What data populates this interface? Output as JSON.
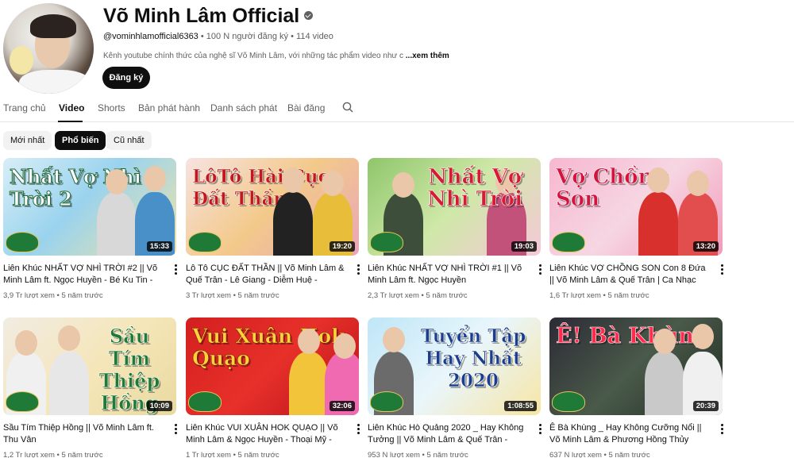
{
  "channel": {
    "name": "Võ Minh Lâm Official",
    "handle": "@vominhlamofficial6363",
    "subscribers": "100 N người đăng ký",
    "video_count": "114 video",
    "separator": "•",
    "description": "Kênh youtube chính thức của nghệ sĩ Võ Minh Lâm, với những tác phẩm video như c",
    "more_label": "...xem thêm",
    "subscribe_label": "Đăng ký"
  },
  "tabs": [
    {
      "label": "Trang chủ",
      "active": false
    },
    {
      "label": "Video",
      "active": true
    },
    {
      "label": "Shorts",
      "active": false
    },
    {
      "label": "Bản phát hành",
      "active": false
    },
    {
      "label": "Danh sách phát",
      "active": false
    },
    {
      "label": "Bài đăng",
      "active": false
    }
  ],
  "search_icon": "search-icon",
  "filters": [
    {
      "label": "Mới nhất",
      "active": false
    },
    {
      "label": "Phổ biến",
      "active": true
    },
    {
      "label": "Cũ nhất",
      "active": false
    }
  ],
  "videos": [
    {
      "title": "Liên Khúc NHẤT VỢ NHÌ TRỜI #2 || Võ Minh Lâm ft. Ngọc Huyền - Bé Ku Tin - Diễm Huệ",
      "views": "3,9 Tr lượt xem",
      "age": "5 năm trước",
      "duration": "15:33",
      "thumb_text": "Nhất Vợ Nhì Trời 2"
    },
    {
      "title": "Lô Tô CỤC ĐẤT THẦN || Võ Minh Lâm & Quế Trân - Lê Giang - Diễm Huệ - Cường Phạm",
      "views": "3 Tr lượt xem",
      "age": "5 năm trước",
      "duration": "19:20",
      "thumb_text": "LôTô Hài Cục Đất Thần"
    },
    {
      "title": "Liên Khúc NHẤT VỢ NHÌ TRỜI #1 || Võ Minh Lâm ft. Ngọc Huyền",
      "views": "2,3 Tr lượt xem",
      "age": "5 năm trước",
      "duration": "19:03",
      "thumb_text": "Nhất Vợ Nhì Trời"
    },
    {
      "title": "Liên Khúc VỢ CHỒNG SON Con 8 Đứa || Võ Minh Lâm & Quế Trân | Ca Nhạc Hài",
      "views": "1,6 Tr lượt xem",
      "age": "5 năm trước",
      "duration": "13:20",
      "thumb_text": "Vợ Chồng Son"
    },
    {
      "title": "Sầu Tím Thiệp Hồng || Võ Minh Lâm ft. Thu Vân",
      "views": "1,2 Tr lượt xem",
      "age": "5 năm trước",
      "duration": "10:09",
      "thumb_text": "Sầu Tím Thiệp Hồng"
    },
    {
      "title": "Liên Khúc VUI XUÂN HOK QUẠO || Võ Minh Lâm & Ngọc Huyền - Thoại Mỹ - Tấn Beo",
      "views": "1 Tr lượt xem",
      "age": "5 năm trước",
      "duration": "32:06",
      "thumb_text": "Vui Xuân Hok Quạo"
    },
    {
      "title": "Liên Khúc Hò Quảng 2020 _ Hay Không Tưởng || Võ Minh Lâm & Quế Trân - Nhiều...",
      "views": "953 N lượt xem",
      "age": "5 năm trước",
      "duration": "1:08:55",
      "thumb_text": "Tuyển Tập Hay Nhất 2020"
    },
    {
      "title": "Ê Bà Khùng _ Hay Không Cưỡng Nổi || Võ Minh Lâm & Phương Hồng Thủy",
      "views": "637 N lượt xem",
      "age": "5 năm trước",
      "duration": "20:39",
      "thumb_text": "Ê! Bà Khùng"
    }
  ],
  "colors": {
    "accent": "#0f0f0f",
    "meta": "#606060",
    "chip_bg": "#f2f2f2"
  }
}
